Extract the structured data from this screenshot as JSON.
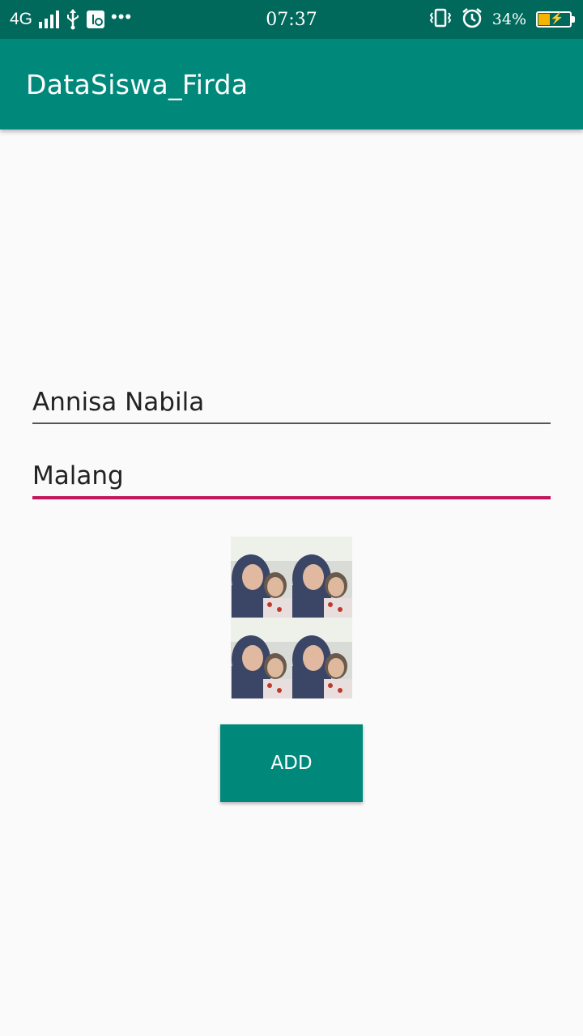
{
  "status_bar": {
    "network": "4G",
    "time": "07:37",
    "battery_percent": "34%",
    "battery_level": 0.34,
    "icons": [
      "signal-icon",
      "usb-icon",
      "usb-debug-icon",
      "more-dots-icon",
      "vibrate-icon",
      "alarm-icon",
      "battery-charging-icon"
    ]
  },
  "app_bar": {
    "title": "DataSiswa_Firda"
  },
  "form": {
    "name_value": "Annisa Nabila",
    "city_value": "Malang",
    "add_label": "ADD"
  },
  "colors": {
    "status_bar": "#00695c",
    "primary": "#00897b",
    "accent": "#c2185b",
    "background": "#fafafa"
  }
}
